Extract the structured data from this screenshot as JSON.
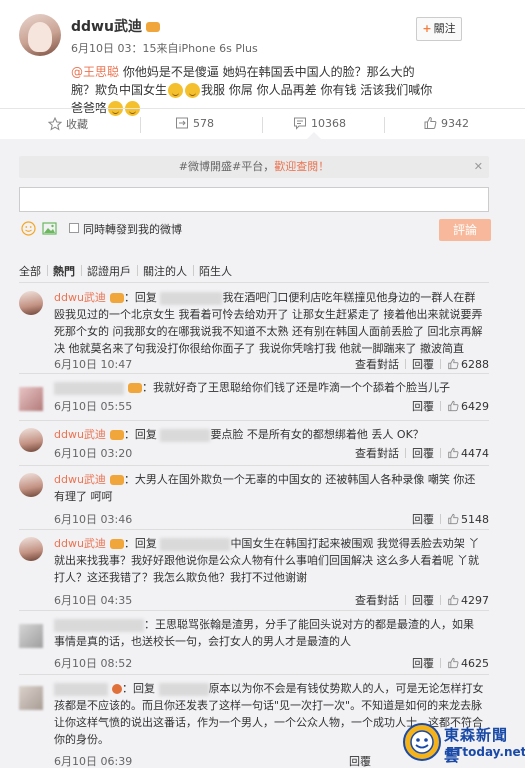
{
  "post": {
    "username": "ddwu武迪",
    "meta": "6月10日 03：15来自iPhone 6s Plus",
    "follow_label": "關注",
    "follow_symbol": "+",
    "text_mention": "@王思聪",
    "text_part1": " 你他妈是不是傻逼 她妈在韩国丢中国人的脸？那么大的腕？欺负中国女生",
    "text_part2": "我服 你屌 你人品再差 你有钱 活该我们喊你爸爸咯",
    "icons": [
      "avatar",
      "vip-badge",
      "smile-emoji"
    ]
  },
  "actions": {
    "favorite_label": "收藏",
    "repost_count": "578",
    "comment_count": "10368",
    "like_count": "9342",
    "icons": [
      "star-icon",
      "repost-icon",
      "comment-icon",
      "like-icon"
    ]
  },
  "comment_box": {
    "notice_text": "#微博開盛#平台，",
    "notice_link": "歡迎查閱！",
    "notice_close": "✕",
    "input_value": "",
    "repost_checkbox_label": "同時轉發到我的微博",
    "submit_label": "評論"
  },
  "filters": [
    "全部",
    "熱門",
    "認證用戶",
    "關注的人",
    "陌生人"
  ],
  "comments": [
    {
      "name": "ddwu武迪",
      "text": "：回复 ",
      "text2": "我在酒吧门口便利店吃年糕撞见他身边的一群人在群殴我见过的一个北京女生 我看着可怜去给劝开了 让那女生赶紧走了 接着他出来就说要弄死那个女的 问我那女的在哪我说我不知道不太熟 还有别在韩国人面前丢脸了 回北京再解决 他就莫名来了句我没打你很给你面子了 我说你凭啥打我 他就一脚踹来了 撤波简直",
      "time": "6月10日 10:47",
      "report": "查看對話",
      "reply": "回覆",
      "likes": "6288"
    },
    {
      "name": "",
      "text": "：我就好奇了王思聪给你们钱了还是咋滴一个个舔着个脸当儿子",
      "time": "6月10日 05:55",
      "report": "",
      "reply": "回覆",
      "likes": "6429"
    },
    {
      "name": "ddwu武迪",
      "text": "：回复 ",
      "text2": "要点脸 不是所有女的都想绑着他 丢人 OK？",
      "time": "6月10日 03:20",
      "report": "查看對話",
      "reply": "回覆",
      "likes": "4474"
    },
    {
      "name": "ddwu武迪",
      "text": "：大男人在国外欺负一个无辜的中国女的 还被韩国人各种录像 嘲笑 你还有理了 呵呵",
      "time": "6月10日 03:46",
      "report": "",
      "reply": "回覆",
      "likes": "5148"
    },
    {
      "name": "ddwu武迪",
      "text": "：回复 ",
      "text2": "中国女生在韩国打起来被围观 我觉得丢脸去劝架 丫就出来找我事？我好好跟他说你是公众人物有什么事咱们回国解决 这么多人看着呢 丫就打人？这还我错了？我怎么欺负他？我打不过他谢谢",
      "time": "6月10日 04:35",
      "report": "查看對話",
      "reply": "回覆",
      "likes": "4297"
    },
    {
      "name": "",
      "text": "：王思聪骂张翰是渣男，分手了能回头说对方的都是最渣的人，如果事情是真的话，也送校长一句，会打女人的男人才是最渣的人",
      "time": "6月10日 08:52",
      "report": "",
      "reply": "回覆",
      "likes": "4625"
    },
    {
      "name": "",
      "text": "：回复 ",
      "text2": "原本以为你不会是有钱仗势欺人的人，可是无论怎样打女孩都是不应该的。而且你还发表了这样一句话\"见一次打一次\"。不知道是如何的来龙去脉让你这样气愤的说出这番话，作为一个男人，一个公众人物，一个成功人士，这都不符合你的身份。",
      "time": "6月10日 06:39",
      "report": "",
      "reply": "回覆",
      "likes": ""
    }
  ],
  "watermark": {
    "line1": "東森新聞雲",
    "line2": "ETtoday.net"
  },
  "colors": {
    "accent": "#eb7350",
    "submit_bg": "#f7b89b",
    "panel_bg": "#f2f2f5",
    "watermark_blue": "#1a4aa8"
  }
}
